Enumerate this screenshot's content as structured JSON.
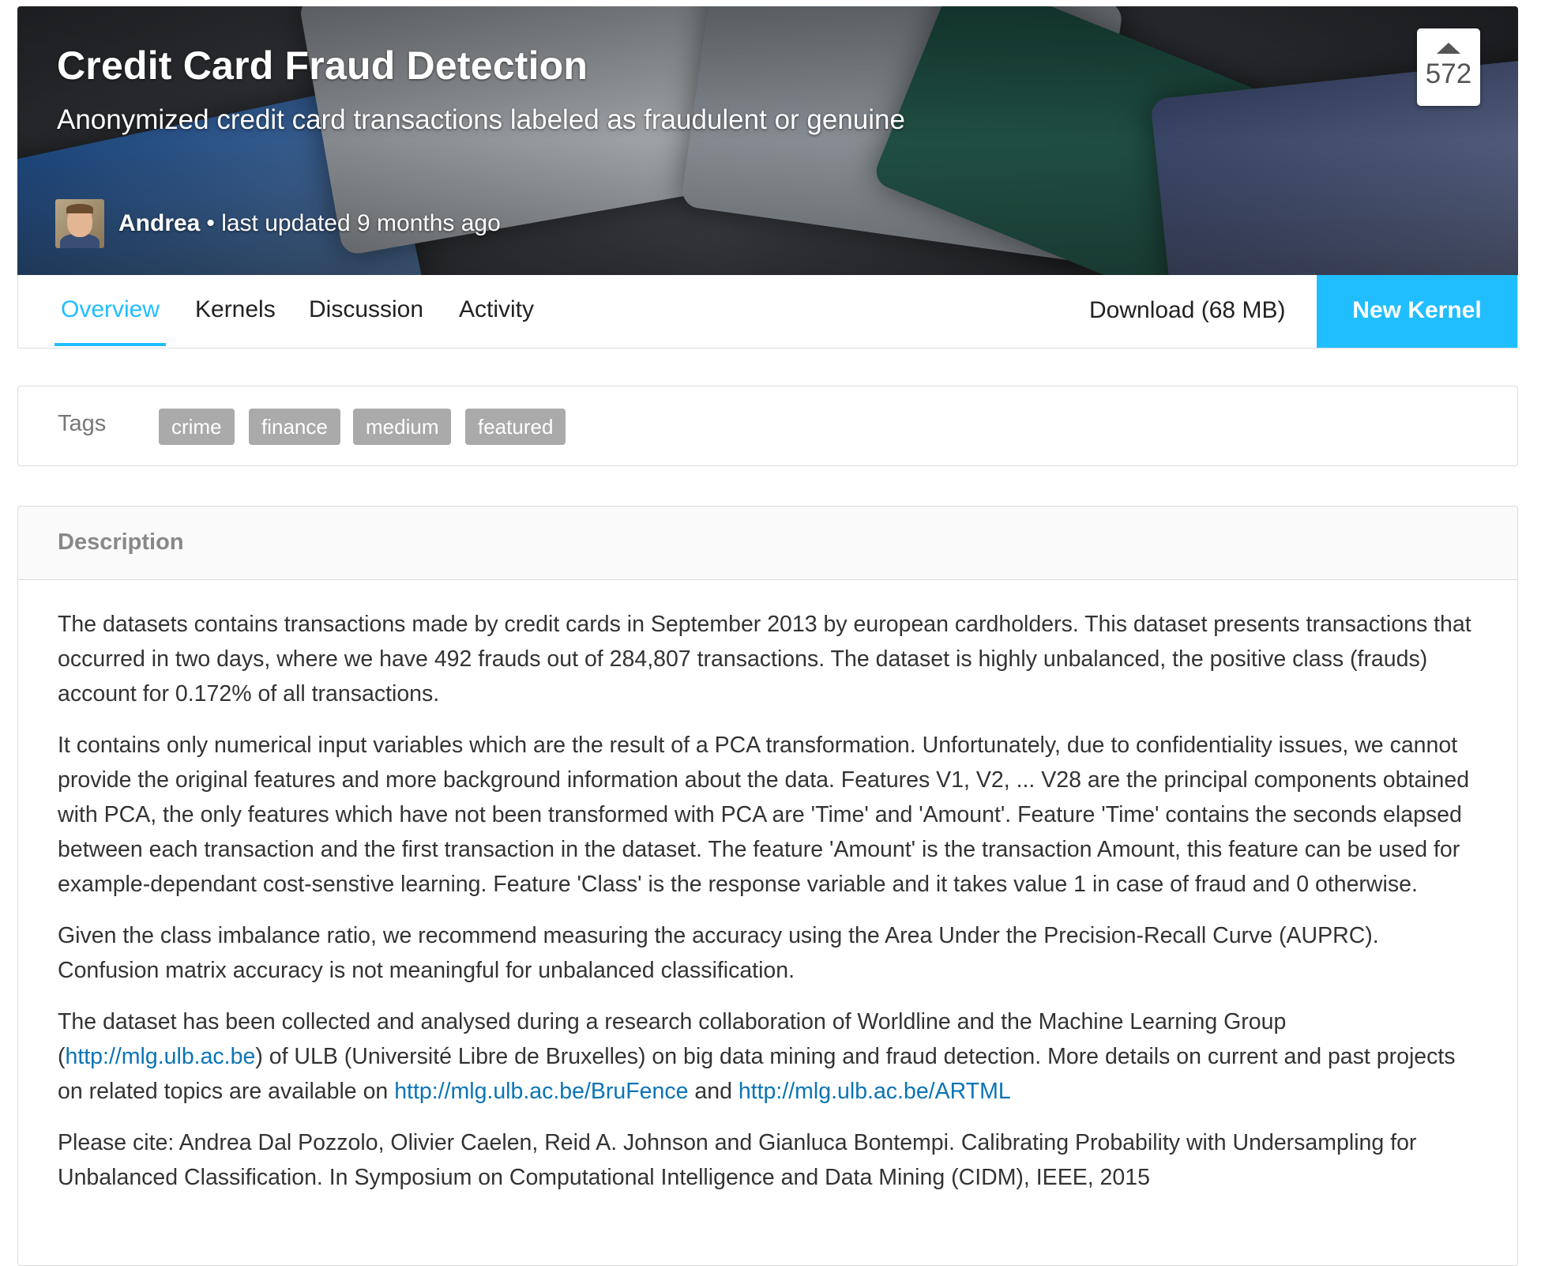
{
  "header": {
    "title": "Credit Card Fraud Detection",
    "subtitle": "Anonymized credit card transactions labeled as fraudulent or genuine",
    "votes": "572",
    "author": "Andrea",
    "updated": "• last updated 9 months ago"
  },
  "tabs": [
    {
      "label": "Overview",
      "active": true
    },
    {
      "label": "Kernels",
      "active": false
    },
    {
      "label": "Discussion",
      "active": false
    },
    {
      "label": "Activity",
      "active": false
    }
  ],
  "actions": {
    "download": "Download (68 MB)",
    "new_kernel": "New Kernel"
  },
  "tags": {
    "label": "Tags",
    "items": [
      "crime",
      "finance",
      "medium",
      "featured"
    ]
  },
  "description": {
    "title": "Description",
    "p1": "The datasets contains transactions made by credit cards in September 2013 by european cardholders. This dataset presents transactions that occurred in two days, where we have 492 frauds out of 284,807 transactions. The dataset is highly unbalanced, the positive class (frauds) account for 0.172% of all transactions.",
    "p2": "It contains only numerical input variables which are the result of a PCA transformation. Unfortunately, due to confidentiality issues, we cannot provide the original features and more background information about the data. Features V1, V2, ... V28 are the principal components obtained with PCA, the only features which have not been transformed with PCA are 'Time' and 'Amount'. Feature 'Time' contains the seconds elapsed between each transaction and the first transaction in the dataset. The feature 'Amount' is the transaction Amount, this feature can be used for example-dependant cost-senstive learning. Feature 'Class' is the response variable and it takes value 1 in case of fraud and 0 otherwise.",
    "p3": "Given the class imbalance ratio, we recommend measuring the accuracy using the Area Under the Precision-Recall Curve (AUPRC). Confusion matrix accuracy is not meaningful for unbalanced classification.",
    "p4_a": "The dataset has been collected and analysed during a research collaboration of Worldline and the Machine Learning Group (",
    "p4_link1": "http://mlg.ulb.ac.be",
    "p4_b": ") of ULB (Université Libre de Bruxelles) on big data mining and fraud detection. More details on current and past projects on related topics are available on ",
    "p4_link2": "http://mlg.ulb.ac.be/BruFence",
    "p4_c": " and ",
    "p4_link3": "http://mlg.ulb.ac.be/ARTML",
    "p5": "Please cite: Andrea Dal Pozzolo, Olivier Caelen, Reid A. Johnson and Gianluca Bontempi. Calibrating Probability with Undersampling for Unbalanced Classification. In Symposium on Computational Intelligence and Data Mining (CIDM), IEEE, 2015"
  },
  "colors": {
    "accent": "#20beff",
    "link": "#0a74b5",
    "tag_bg": "#aaaaaa"
  }
}
